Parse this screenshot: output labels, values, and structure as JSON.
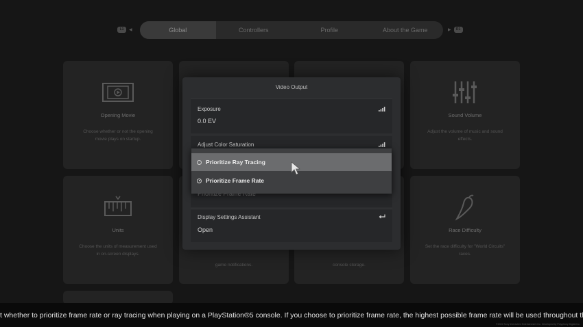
{
  "nav": {
    "left_button": "L1",
    "right_button": "R1",
    "tabs": [
      "Global",
      "Controllers",
      "Profile",
      "About the Game"
    ],
    "active_tab": "Global"
  },
  "cards": [
    {
      "title": "Opening Movie",
      "desc": "Choose whether or not the opening movie plays on startup.",
      "icon": "film-icon"
    },
    {
      "title": "Sound Volume",
      "desc": "Adjust the volume of music and sound effects.",
      "icon": "equalizer-icon"
    },
    {
      "title": "Units",
      "desc": "Choose the units of measurement used in on-screen displays.",
      "icon": "ruler-icon"
    },
    {
      "title": "",
      "desc": "game notifications.",
      "icon": ""
    },
    {
      "title": "",
      "desc": "console storage.",
      "icon": ""
    },
    {
      "title": "Race Difficulty",
      "desc": "Set the race difficulty for \"World Circuits\" races.",
      "icon": "chili-pepper-icon"
    }
  ],
  "modal": {
    "title": "Video Output",
    "rows": [
      {
        "label": "Exposure",
        "value": "0.0 EV",
        "icon": "signal-bars-icon"
      },
      {
        "label": "Adjust Color Saturation",
        "value": "",
        "icon": "signal-bars-icon"
      },
      {
        "label": "",
        "value": "Prioritize Frame Rate",
        "icon": ""
      },
      {
        "label": "Display Settings Assistant",
        "value": "Open",
        "icon": "return-icon"
      }
    ]
  },
  "dropdown": {
    "options": [
      {
        "label": "Prioritize Ray Tracing",
        "selected": false,
        "highlighted": true
      },
      {
        "label": "Prioritize Frame Rate",
        "selected": true,
        "highlighted": false
      }
    ]
  },
  "footer": {
    "description": "t whether to prioritize frame rate or ray tracing when playing on a PlayStation®5 console. If you choose to prioritize frame rate, the highest possible frame rate will be used throughout the",
    "copyright": "©2022 Sony Interactive Entertainment Inc. Developed by Polyphony Digital Inc."
  }
}
